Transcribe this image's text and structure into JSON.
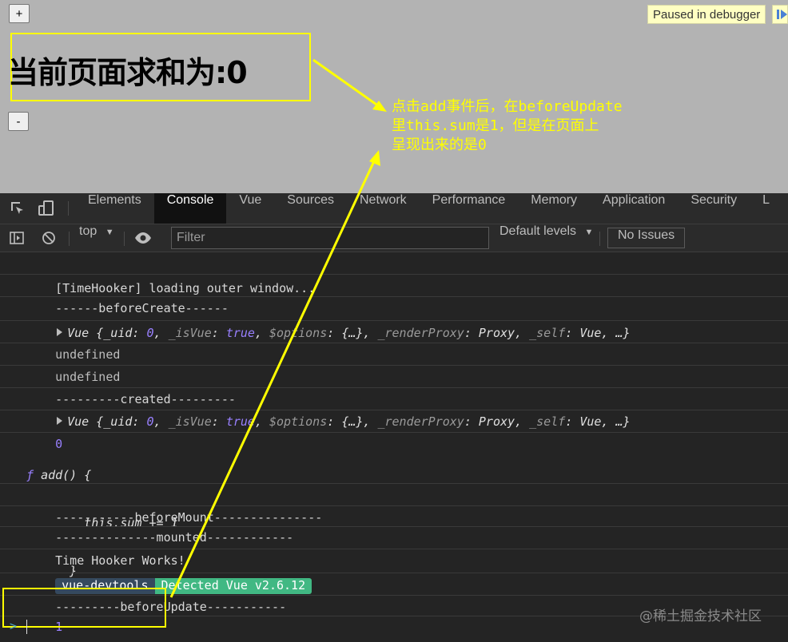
{
  "page": {
    "plus_label": "+",
    "minus_label": "-",
    "heading": "当前页面求和为:0",
    "paused_label": "Paused in debugger",
    "annotation": "点击add事件后，在beforeUpdate\n里this.sum是1，但是在页面上\n呈现出来的是0"
  },
  "devtools": {
    "tabs": [
      "Elements",
      "Console",
      "Vue",
      "Sources",
      "Network",
      "Performance",
      "Memory",
      "Application",
      "Security",
      "L"
    ],
    "active_tab": "Console",
    "context": "top",
    "filter_placeholder": "Filter",
    "levels": "Default levels",
    "issues": "No Issues"
  },
  "console": {
    "line1": "[TimeHooker] loading outer window...",
    "line2": "------beforeCreate------",
    "vue_prefix": "Vue {_uid: ",
    "uid": "0",
    "isvue_key": "_isVue",
    "isvue_val": "true",
    "options_key": "$options",
    "options_val": "{…}",
    "proxy_key": "_renderProxy",
    "proxy_val": "Proxy",
    "self_key": "_self",
    "self_val": "Vue, …}",
    "undefined1": "undefined",
    "undefined2": "undefined",
    "created": "---------created---------",
    "zero": "0",
    "fn_symbol": "ƒ",
    "fn_sig": "add() {",
    "fn_body": "        this.sum += 1",
    "fn_close": "      }",
    "beforemount": "-----------beforeMount---------------",
    "mounted": "--------------mounted------------",
    "timehooker": "Time Hooker Works!",
    "badge_left": "vue-devtools",
    "badge_right": "Detected Vue v2.6.12",
    "beforeupdate": "---------beforeUpdate-----------",
    "one": "1",
    "prompt": ">"
  },
  "watermark": "@稀土掘金技术社区",
  "colors": {
    "highlight": "#ffff00",
    "active_tab_bg": "#111111",
    "vue_green": "#41b883",
    "vue_navy": "#35495e",
    "number": "#9980ff"
  }
}
